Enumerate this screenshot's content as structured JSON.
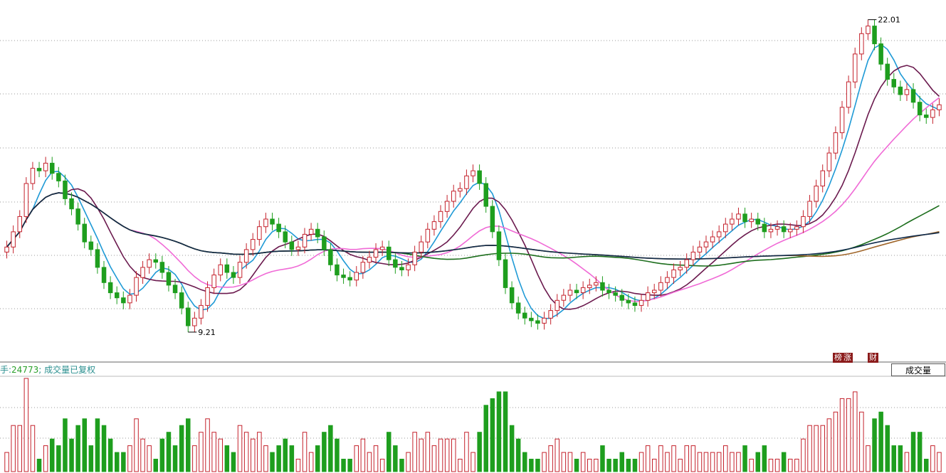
{
  "price_labels": {
    "high": "22.01",
    "low": "9.21"
  },
  "volume_bar": {
    "lead": "手:",
    "value": "24773",
    "suffix": "成交量已复权"
  },
  "badges": [
    "榜",
    "涨",
    "财"
  ],
  "volume_button": "成交量",
  "chart_data": {
    "type": "candlestick",
    "title": "",
    "x": "",
    "xlabel": "",
    "ylabel": "",
    "candles_open": [
      12.8,
      13.0,
      13.6,
      14.2,
      15.5,
      16.1,
      16.0,
      16.3,
      15.9,
      15.6,
      14.9,
      14.5,
      13.9,
      13.2,
      12.9,
      12.2,
      11.6,
      11.2,
      11.0,
      10.8,
      11.1,
      11.8,
      12.2,
      12.5,
      12.4,
      12.0,
      11.5,
      11.2,
      10.6,
      9.9,
      10.2,
      10.7,
      11.4,
      11.9,
      12.3,
      12.0,
      11.8,
      12.4,
      12.9,
      13.3,
      13.8,
      14.1,
      13.9,
      13.6,
      13.2,
      12.9,
      13.0,
      13.5,
      13.7,
      13.4,
      12.9,
      12.3,
      11.9,
      11.8,
      11.7,
      12.0,
      12.4,
      12.6,
      12.9,
      13.0,
      12.5,
      12.2,
      12.1,
      12.3,
      12.8,
      13.2,
      13.7,
      14.0,
      14.4,
      14.8,
      15.2,
      15.3,
      15.8,
      16.0,
      15.5,
      14.6,
      13.6,
      12.5,
      11.4,
      10.8,
      10.4,
      10.2,
      10.1,
      10.0,
      10.2,
      10.5,
      10.9,
      11.1,
      11.3,
      11.2,
      11.4,
      11.5,
      11.6,
      11.3,
      11.2,
      11.1,
      10.9,
      10.8,
      10.7,
      10.9,
      11.2,
      11.3,
      11.6,
      11.8,
      12.1,
      12.2,
      12.5,
      12.8,
      13.0,
      13.2,
      13.4,
      13.6,
      13.9,
      14.1,
      14.3,
      14.0,
      14.1,
      13.9,
      13.6,
      13.7,
      13.8,
      13.6,
      13.7,
      13.8,
      14.2,
      14.8,
      15.4,
      16.0,
      16.7,
      17.5,
      18.5,
      19.5,
      20.6,
      21.4,
      21.7,
      21.0,
      20.2,
      19.6,
      19.3,
      19.0,
      19.2,
      18.7,
      18.2,
      18.1,
      18.4
    ],
    "candles_close": [
      13.0,
      13.6,
      14.2,
      15.5,
      16.1,
      16.0,
      16.3,
      15.9,
      15.6,
      14.9,
      14.5,
      13.9,
      13.2,
      12.9,
      12.2,
      11.6,
      11.2,
      11.0,
      10.8,
      11.1,
      11.8,
      12.2,
      12.5,
      12.4,
      12.0,
      11.5,
      11.2,
      10.6,
      9.9,
      10.2,
      10.7,
      11.4,
      11.9,
      12.3,
      12.0,
      11.8,
      12.4,
      12.9,
      13.3,
      13.8,
      14.1,
      13.9,
      13.6,
      13.2,
      12.9,
      13.0,
      13.5,
      13.7,
      13.4,
      12.9,
      12.3,
      11.9,
      11.8,
      11.7,
      12.0,
      12.4,
      12.6,
      12.9,
      13.0,
      12.5,
      12.2,
      12.1,
      12.3,
      12.8,
      13.2,
      13.7,
      14.0,
      14.4,
      14.8,
      15.2,
      15.3,
      15.8,
      16.0,
      15.5,
      14.6,
      13.6,
      12.5,
      11.4,
      10.8,
      10.4,
      10.2,
      10.1,
      10.0,
      10.2,
      10.5,
      10.9,
      11.1,
      11.3,
      11.2,
      11.4,
      11.5,
      11.6,
      11.3,
      11.2,
      11.1,
      10.9,
      10.8,
      10.7,
      10.9,
      11.2,
      11.3,
      11.6,
      11.8,
      12.1,
      12.2,
      12.5,
      12.8,
      13.0,
      13.2,
      13.4,
      13.6,
      13.9,
      14.1,
      14.3,
      14.0,
      14.1,
      13.9,
      13.6,
      13.7,
      13.8,
      13.6,
      13.7,
      13.8,
      14.2,
      14.8,
      15.4,
      16.0,
      16.7,
      17.5,
      18.5,
      19.5,
      20.6,
      21.4,
      21.7,
      21.0,
      20.2,
      19.6,
      19.3,
      19.0,
      19.2,
      18.7,
      18.2,
      18.1,
      18.4,
      18.6
    ]
  }
}
